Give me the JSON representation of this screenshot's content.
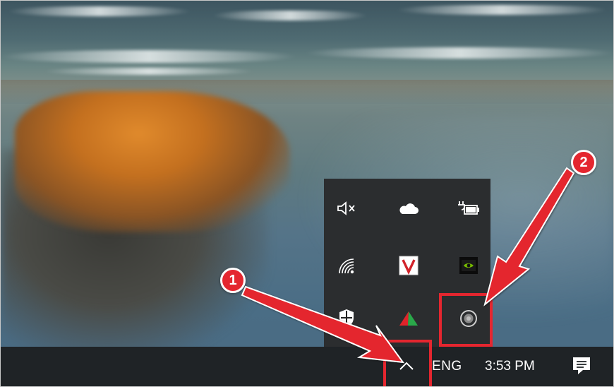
{
  "taskbar": {
    "language": "ENG",
    "time": "3:53 PM",
    "show_hidden_icons": "chevron-up-icon",
    "action_center": "action-center-icon"
  },
  "tray_icons": [
    "volume-muted-icon",
    "onedrive-cloud-icon",
    "battery-charging-icon",
    "wifi-icon",
    "v-app-icon",
    "nvidia-icon",
    "windows-defender-shield-icon",
    "triangle-app-icon",
    "target-app-icon"
  ],
  "annotations": {
    "badge_1": "1",
    "badge_2": "2",
    "accent_color": "#e4262f"
  }
}
